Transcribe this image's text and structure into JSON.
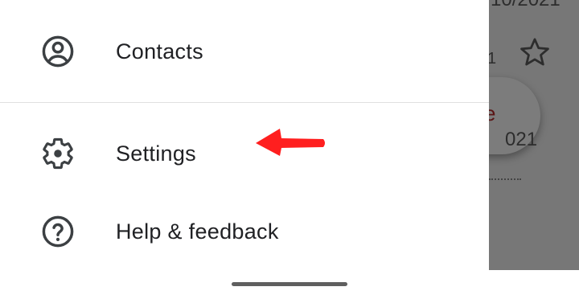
{
  "drawer": {
    "items": [
      {
        "label": "Contacts",
        "icon": "account-circle-icon"
      },
      {
        "label": "Settings",
        "icon": "gear-icon"
      },
      {
        "label": "Help & feedback",
        "icon": "help-circle-icon"
      }
    ]
  },
  "background": {
    "date_top": "10/2021",
    "small_char": "1",
    "fab_letter": "e",
    "date_second": "021"
  },
  "colors": {
    "text": "#202124",
    "icon": "#3c4043",
    "annotation_arrow": "#ff1f1f",
    "scrim": "#777777"
  }
}
